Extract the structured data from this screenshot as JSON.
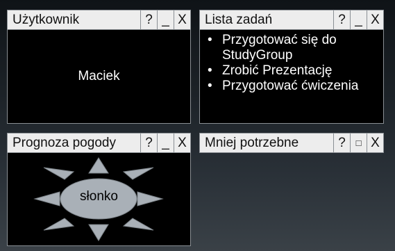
{
  "widgets": {
    "user": {
      "title": "Użytkownik",
      "name": "Maciek",
      "controls": {
        "help": "?",
        "minimize": "_",
        "close": "X"
      }
    },
    "tasks": {
      "title": "Lista zadań",
      "items": [
        "Przygotować się do StudyGroup",
        "Zrobić Prezentację",
        "Przygotować ćwiczenia"
      ],
      "bullet": "•",
      "controls": {
        "help": "?",
        "minimize": "_",
        "close": "X"
      }
    },
    "weather": {
      "title": "Prognoza pogody",
      "condition": "słonko",
      "icon": "sun-icon",
      "controls": {
        "help": "?",
        "minimize": "_",
        "close": "X"
      }
    },
    "less_needed": {
      "title": "Mniej potrzebne",
      "state": "minimized",
      "controls": {
        "help": "?",
        "maximize": "□",
        "close": "X"
      }
    }
  },
  "colors": {
    "titlebar": "#ededed",
    "border": "#8a8f94",
    "widget_body": "#000000",
    "sun_fill": "#a9b0b7"
  }
}
